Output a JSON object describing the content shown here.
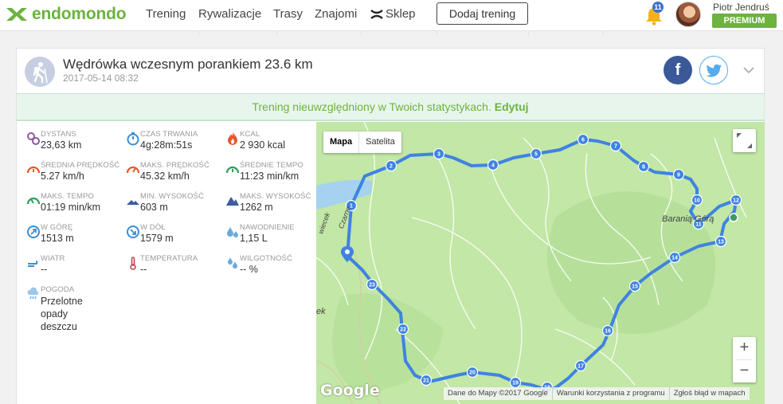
{
  "nav": {
    "brand": "endomondo",
    "links": [
      "Trening",
      "Rywalizacje",
      "Trasy",
      "Znajomi"
    ],
    "shop": "Sklep",
    "add_button": "Dodaj trening",
    "notifications_count": "11",
    "user_name": "Piotr Jendruś",
    "premium": "PREMIUM"
  },
  "workout": {
    "title": "Wędrówka wczesnym porankiem 23.6 km",
    "date": "2017-05-14 08:32",
    "sport_icon": "hiking-icon",
    "share_facebook": "f"
  },
  "banner": {
    "text": "Trening nieuwzględniony w Twoich statystykach.",
    "edit": "Edytuj"
  },
  "stats": [
    {
      "label": "DYSTANS",
      "value": "23,63 km",
      "icon": "distance-icon",
      "color": "#8e5a9e"
    },
    {
      "label": "CZAS TRWANIA",
      "value": "4g:28m:51s",
      "icon": "stopwatch-icon",
      "color": "#3a8fd6"
    },
    {
      "label": "KCAL",
      "value": "2 930 kcal",
      "icon": "flame-icon",
      "color": "#e8582c"
    },
    {
      "label": "ŚREDNIA PRĘDKOŚĆ",
      "value": "5.27 km/h",
      "icon": "speedometer-icon",
      "color": "#e8582c"
    },
    {
      "label": "MAKS. PRĘDKOŚĆ",
      "value": "45.32 km/h",
      "icon": "speedometer-max-icon",
      "color": "#e8582c"
    },
    {
      "label": "ŚREDNIE TEMPO",
      "value": "11:23 min/km",
      "icon": "pace-icon",
      "color": "#2e9e5b"
    },
    {
      "label": "MAKS. TEMPO",
      "value": "01:19 min/km",
      "icon": "pace-max-icon",
      "color": "#2e9e5b"
    },
    {
      "label": "MIN. WYSOKOŚĆ",
      "value": "603 m",
      "icon": "mountain-min-icon",
      "color": "#3a5c9e"
    },
    {
      "label": "MAKS. WYSOKOŚĆ",
      "value": "1262 m",
      "icon": "mountain-max-icon",
      "color": "#3a5c9e"
    },
    {
      "label": "W GÓRĘ",
      "value": "1513 m",
      "icon": "ascent-icon",
      "color": "#3a8fd6"
    },
    {
      "label": "W DÓŁ",
      "value": "1579 m",
      "icon": "descent-icon",
      "color": "#3a8fd6"
    },
    {
      "label": "NAWODNIENIE",
      "value": "1,15 L",
      "icon": "water-drops-icon",
      "color": "#6aaae0"
    },
    {
      "label": "WIATR",
      "value": "--",
      "icon": "wind-icon",
      "color": "#3a8fd6"
    },
    {
      "label": "TEMPERATURA",
      "value": "--",
      "icon": "thermometer-icon",
      "color": "#c0455a"
    },
    {
      "label": "WILGOTNOŚĆ",
      "value": "-- %",
      "icon": "humidity-icon",
      "color": "#6aaae0"
    },
    {
      "label": "POGODA",
      "value": "Przelotne opady deszczu",
      "icon": "rain-cloud-icon",
      "color": "#6aaae0"
    }
  ],
  "map": {
    "view_map": "Mapa",
    "view_satellite": "Satelita",
    "zoom_in": "+",
    "zoom_out": "−",
    "google": "Google",
    "place_label": "Baranią Górą",
    "road_labels": [
      "Czarne",
      "wiecek",
      "ek"
    ],
    "attribution": [
      "Dane do Mapy ©2017 Google",
      "Warunki korzystania z programu",
      "Zgłoś błąd w mapach"
    ],
    "route_color": "#3f83e0",
    "km_markers": [
      "1",
      "2",
      "3",
      "4",
      "5",
      "6",
      "7",
      "8",
      "9",
      "10",
      "11",
      "12",
      "13",
      "14",
      "15",
      "16",
      "17",
      "18",
      "19",
      "20",
      "21",
      "22",
      "23"
    ]
  }
}
